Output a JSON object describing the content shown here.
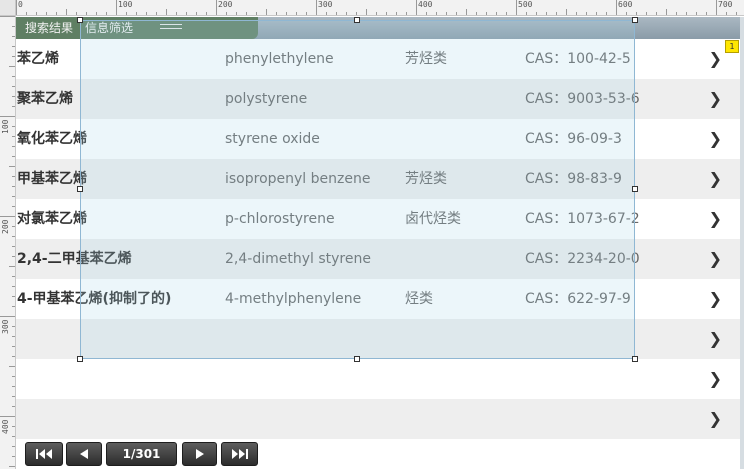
{
  "ruler": {
    "top_labels": [
      "0",
      "100",
      "200",
      "300",
      "400",
      "500",
      "600",
      "700"
    ],
    "left_labels": [
      "100",
      "200",
      "300",
      "400"
    ]
  },
  "header": {
    "tab_results": "搜索结果",
    "tab_filter": "信息筛选",
    "menu_icon": "hamburger-icon"
  },
  "rows": [
    {
      "name": "苯乙烯",
      "english": "phenylethylene",
      "category": "芳烃类",
      "cas": "CAS：100-42-5"
    },
    {
      "name": "聚苯乙烯",
      "english": "polystyrene",
      "category": "",
      "cas": "CAS：9003-53-6"
    },
    {
      "name": "氧化苯乙烯",
      "english": "styrene oxide",
      "category": "",
      "cas": "CAS：96-09-3"
    },
    {
      "name": "甲基苯乙烯",
      "english": "isopropenyl benzene",
      "category": "芳烃类",
      "cas": "CAS：98-83-9"
    },
    {
      "name": "对氯苯乙烯",
      "english": "p-chlorostyrene",
      "category": "卤代烃类",
      "cas": "CAS：1073-67-2"
    },
    {
      "name": "2,4-二甲基苯乙烯",
      "english": "2,4-dimethyl styrene",
      "category": "",
      "cas": "CAS：2234-20-0"
    },
    {
      "name": "4-甲基苯乙烯(抑制了的)",
      "english": "4-methylphenylene",
      "category": "烃类",
      "cas": "CAS：622-97-9"
    },
    {
      "name": "",
      "english": "",
      "category": "",
      "cas": ""
    },
    {
      "name": "",
      "english": "",
      "category": "",
      "cas": ""
    },
    {
      "name": "",
      "english": "",
      "category": "",
      "cas": ""
    }
  ],
  "chevron": "❯",
  "badge": "1",
  "pager": {
    "page_indicator": "1/301"
  }
}
